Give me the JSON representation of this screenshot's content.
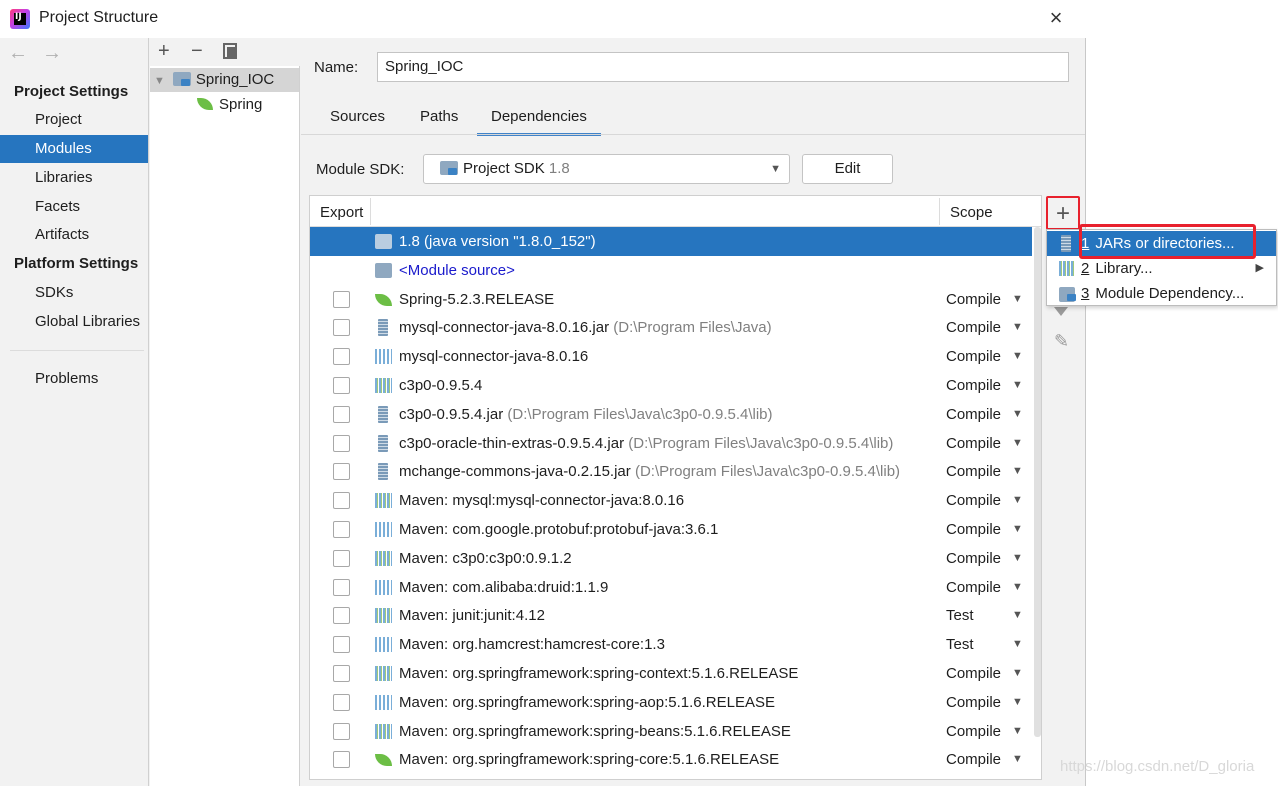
{
  "window": {
    "title": "Project Structure",
    "close_glyph": "×"
  },
  "nav": {
    "back_glyph": "←",
    "forward_glyph": "→",
    "project_settings_header": "Project Settings",
    "project_settings_items": [
      "Project",
      "Modules",
      "Libraries",
      "Facets",
      "Artifacts"
    ],
    "selected_item": "Modules",
    "platform_settings_header": "Platform Settings",
    "platform_settings_items": [
      "SDKs",
      "Global Libraries"
    ],
    "problems": "Problems"
  },
  "tree": {
    "toolbar": {
      "add": "+",
      "remove": "−"
    },
    "expand_glyph": "▼",
    "module_name": "Spring_IOC",
    "facet_name": "Spring"
  },
  "module": {
    "name_label": "Name:",
    "name_value": "Spring_IOC",
    "tabs": [
      "Sources",
      "Paths",
      "Dependencies"
    ],
    "active_tab": "Dependencies",
    "sdk_label": "Module SDK:",
    "sdk_value": "Project SDK",
    "sdk_version": "1.8",
    "edit_label": "Edit"
  },
  "deps_table": {
    "headers": {
      "export": "Export",
      "scope": "Scope"
    },
    "rows": [
      {
        "icon": "jdk-folder-icon",
        "name": "1.8 (java version \"1.8.0_152\")",
        "path": "",
        "scope": "",
        "checkbox": false,
        "selected": true
      },
      {
        "icon": "module-source-icon",
        "name": "<Module source>",
        "path": "",
        "scope": "",
        "checkbox": false,
        "link": true
      },
      {
        "icon": "spring-icon",
        "name": "Spring-5.2.3.RELEASE",
        "path": "",
        "scope": "Compile",
        "checkbox": true
      },
      {
        "icon": "jar-icon",
        "name": "mysql-connector-java-8.0.16.jar",
        "path": "(D:\\Program Files\\Java)",
        "scope": "Compile",
        "checkbox": true
      },
      {
        "icon": "library-icon",
        "name": "mysql-connector-java-8.0.16",
        "path": "",
        "scope": "Compile",
        "checkbox": true
      },
      {
        "icon": "library-icon",
        "name": "c3p0-0.9.5.4",
        "path": "",
        "scope": "Compile",
        "checkbox": true
      },
      {
        "icon": "jar-icon",
        "name": "c3p0-0.9.5.4.jar",
        "path": "(D:\\Program Files\\Java\\c3p0-0.9.5.4\\lib)",
        "scope": "Compile",
        "checkbox": true
      },
      {
        "icon": "jar-icon",
        "name": "c3p0-oracle-thin-extras-0.9.5.4.jar",
        "path": "(D:\\Program Files\\Java\\c3p0-0.9.5.4\\lib)",
        "scope": "Compile",
        "checkbox": true
      },
      {
        "icon": "jar-icon",
        "name": "mchange-commons-java-0.2.15.jar",
        "path": "(D:\\Program Files\\Java\\c3p0-0.9.5.4\\lib)",
        "scope": "Compile",
        "checkbox": true
      },
      {
        "icon": "library-icon",
        "name": "Maven: mysql:mysql-connector-java:8.0.16",
        "path": "",
        "scope": "Compile",
        "checkbox": true
      },
      {
        "icon": "library-icon",
        "name": "Maven: com.google.protobuf:protobuf-java:3.6.1",
        "path": "",
        "scope": "Compile",
        "checkbox": true
      },
      {
        "icon": "library-icon",
        "name": "Maven: c3p0:c3p0:0.9.1.2",
        "path": "",
        "scope": "Compile",
        "checkbox": true
      },
      {
        "icon": "library-icon",
        "name": "Maven: com.alibaba:druid:1.1.9",
        "path": "",
        "scope": "Compile",
        "checkbox": true
      },
      {
        "icon": "library-icon",
        "name": "Maven: junit:junit:4.12",
        "path": "",
        "scope": "Test",
        "checkbox": true
      },
      {
        "icon": "library-icon",
        "name": "Maven: org.hamcrest:hamcrest-core:1.3",
        "path": "",
        "scope": "Test",
        "checkbox": true
      },
      {
        "icon": "library-icon",
        "name": "Maven: org.springframework:spring-context:5.1.6.RELEASE",
        "path": "",
        "scope": "Compile",
        "checkbox": true
      },
      {
        "icon": "library-icon",
        "name": "Maven: org.springframework:spring-aop:5.1.6.RELEASE",
        "path": "",
        "scope": "Compile",
        "checkbox": true
      },
      {
        "icon": "library-icon",
        "name": "Maven: org.springframework:spring-beans:5.1.6.RELEASE",
        "path": "",
        "scope": "Compile",
        "checkbox": true
      },
      {
        "icon": "spring-icon",
        "name": "Maven: org.springframework:spring-core:5.1.6.RELEASE",
        "path": "",
        "scope": "Compile",
        "checkbox": true
      }
    ],
    "scope_caret": "▼"
  },
  "side_tools": {
    "add": "+",
    "edit_glyph": "✎"
  },
  "add_menu": {
    "items": [
      {
        "num": "1",
        "label": "JARs or directories...",
        "icon": "jar-icon",
        "selected": true
      },
      {
        "num": "2",
        "label": "Library...",
        "icon": "library-icon",
        "submenu": true
      },
      {
        "num": "3",
        "label": "Module Dependency...",
        "icon": "module-icon"
      }
    ],
    "submenu_glyph": "▶"
  },
  "watermark": "https://blog.csdn.net/D_gloria",
  "colors": {
    "selection": "#2675bf",
    "highlight_box": "#e8212d",
    "link": "#1a1acc"
  }
}
